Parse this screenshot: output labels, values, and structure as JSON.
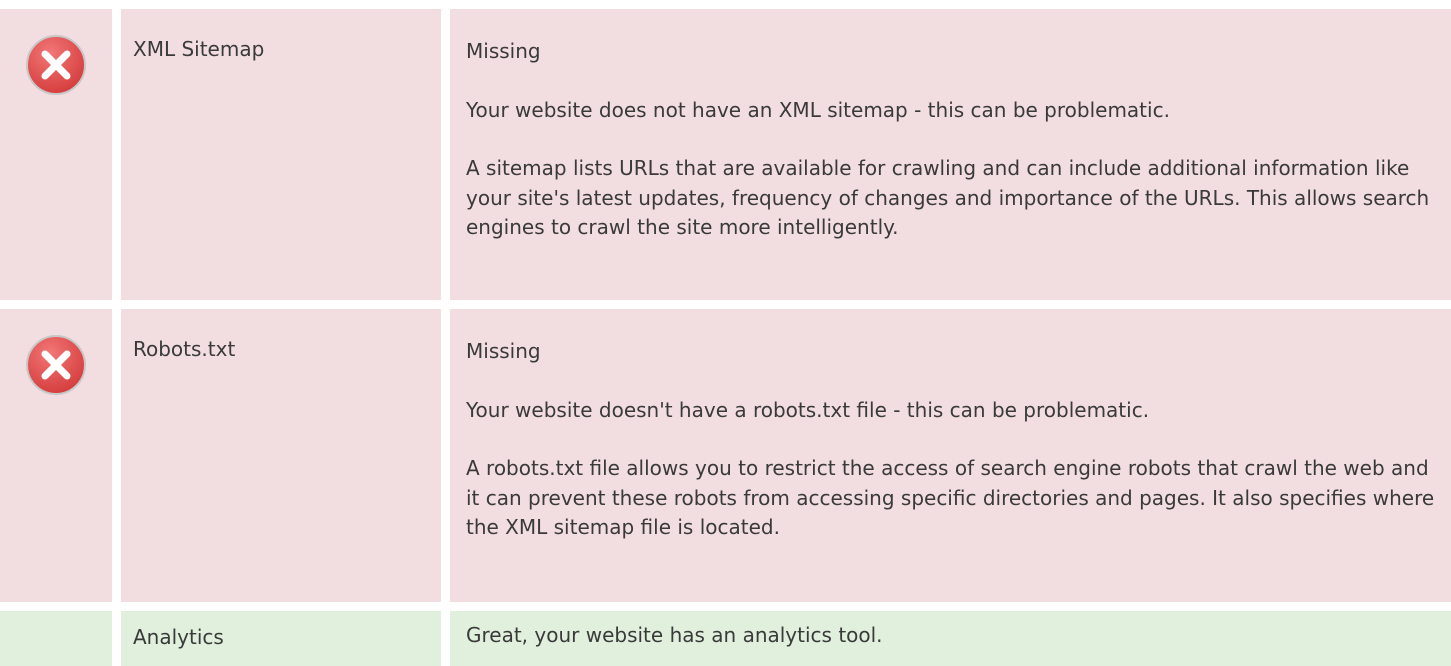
{
  "rows": [
    {
      "label": "XML Sitemap",
      "status": "Missing",
      "summary": "Your website does not have an XML sitemap - this can be problematic.",
      "detail": "A sitemap lists URLs that are available for crawling and can include additional information like your site's latest updates, frequency of changes and importance of the URLs. This allows search engines to crawl the site more intelligently.",
      "icon": "error-x-icon"
    },
    {
      "label": "Robots.txt",
      "status": "Missing",
      "summary": "Your website doesn't have a robots.txt file - this can be problematic.",
      "detail": "A robots.txt file allows you to restrict the access of search engine robots that crawl the web and it can prevent these robots from accessing specific directories and pages. It also specifies where the XML sitemap file is located.",
      "icon": "error-x-icon"
    },
    {
      "label": "Analytics",
      "status": "Great, your website has an analytics tool."
    }
  ],
  "colors": {
    "error_bg": "#f2dde0",
    "ok_bg": "#e0f0dd",
    "icon_red": "#e34f4f"
  }
}
